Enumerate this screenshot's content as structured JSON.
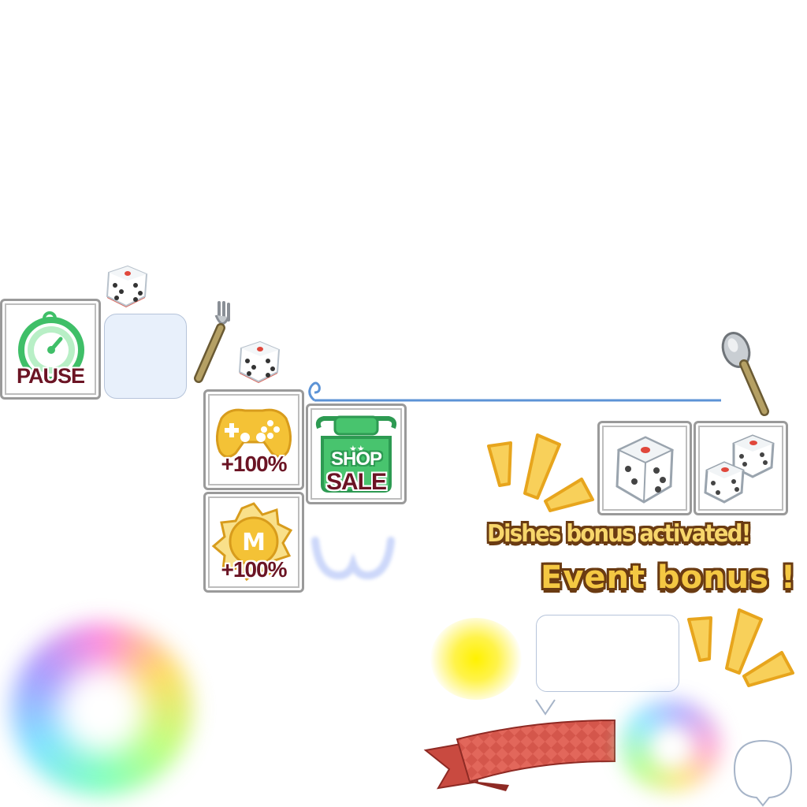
{
  "tiles": {
    "pause": {
      "label": "PAUSE",
      "icon": "stopwatch-icon"
    },
    "game_boost": {
      "label": "+100%",
      "icon": "gamepad-icon"
    },
    "shop_sale": {
      "line1": "SHOP",
      "line2": "SALE",
      "icon": "shop-sign-icon"
    },
    "coin_boost": {
      "label": "+100%",
      "icon": "m-coin-icon"
    },
    "single_die": {
      "icon": "die-icon"
    },
    "double_dice": {
      "icon": "two-dice-icon"
    }
  },
  "banners": {
    "dishes": "Dishes bonus activated!",
    "event": "Event bonus !"
  },
  "colors": {
    "burgundy": "#6b1424",
    "green": "#3fc46a",
    "gold": "#f4c843",
    "ribbon": "#e05b52",
    "link_line": "#5c93d6"
  }
}
